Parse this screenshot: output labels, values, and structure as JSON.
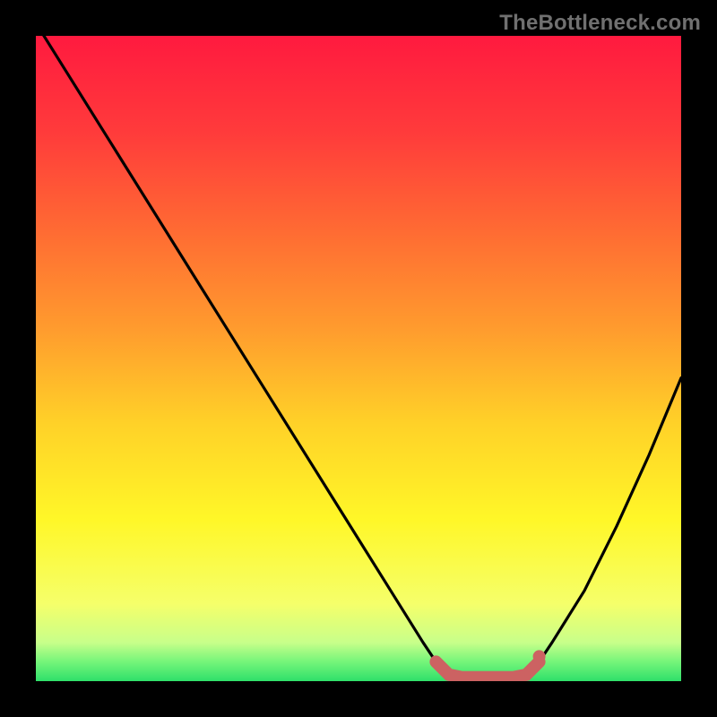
{
  "watermark": "TheBottleneck.com",
  "chart_data": {
    "type": "line",
    "title": "",
    "xlabel": "",
    "ylabel": "",
    "xlim": [
      0,
      100
    ],
    "ylim": [
      0,
      100
    ],
    "series": [
      {
        "name": "bottleneck-curve",
        "x": [
          0,
          5,
          10,
          15,
          20,
          25,
          30,
          35,
          40,
          45,
          50,
          55,
          60,
          62,
          64,
          66,
          68,
          70,
          72,
          74,
          76,
          78,
          80,
          85,
          90,
          95,
          100
        ],
        "y": [
          102,
          94,
          86,
          78,
          70,
          62,
          54,
          46,
          38,
          30,
          22,
          14,
          6,
          3,
          1,
          0,
          0,
          0,
          0,
          0,
          1,
          3,
          6,
          14,
          24,
          35,
          47
        ]
      }
    ],
    "flat_region": {
      "comment": "highlighted near-zero bottleneck band",
      "x_start": 62,
      "x_end": 78,
      "color": "#cc6262"
    },
    "gradient_stops": [
      {
        "offset": 0.0,
        "color": "#ff1a3f"
      },
      {
        "offset": 0.15,
        "color": "#ff3b3b"
      },
      {
        "offset": 0.3,
        "color": "#ff6a33"
      },
      {
        "offset": 0.45,
        "color": "#ff9a2e"
      },
      {
        "offset": 0.6,
        "color": "#ffd128"
      },
      {
        "offset": 0.75,
        "color": "#fff728"
      },
      {
        "offset": 0.88,
        "color": "#f5ff6a"
      },
      {
        "offset": 0.94,
        "color": "#c8ff8a"
      },
      {
        "offset": 0.97,
        "color": "#75f57a"
      },
      {
        "offset": 1.0,
        "color": "#2fe06a"
      }
    ]
  }
}
